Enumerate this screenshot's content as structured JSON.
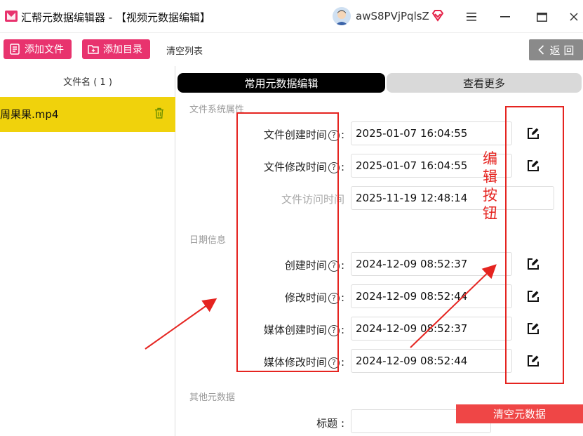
{
  "window": {
    "title": "汇帮元数据编辑器 - 【视频元数据编辑】",
    "username": "awS8PVjPqlsZ"
  },
  "toolbar": {
    "add_file": "添加文件",
    "add_folder": "添加目录",
    "clear_list": "清空列表",
    "back": "返 回"
  },
  "file_list": {
    "header": "文件名 ( 1 )",
    "files": [
      {
        "name": "周果果.mp4"
      }
    ]
  },
  "tabs": {
    "common": "常用元数据编辑",
    "more": "查看更多"
  },
  "sections": {
    "filesystem": "文件系统属性",
    "date": "日期信息",
    "other": "其他元数据"
  },
  "fields": {
    "file_created": {
      "label": "文件创建时间",
      "value": "2025-01-07 16:04:55"
    },
    "file_modified": {
      "label": "文件修改时间",
      "value": "2025-01-07 16:04:55"
    },
    "file_accessed": {
      "label": "文件访问时间",
      "value": "2025-11-19 12:48:14"
    },
    "created": {
      "label": "创建时间",
      "value": "2024-12-09 08:52:37"
    },
    "modified": {
      "label": "修改时间",
      "value": "2024-12-09 08:52:44"
    },
    "media_created": {
      "label": "媒体创建时间",
      "value": "2024-12-09 08:52:37"
    },
    "media_modified": {
      "label": "媒体修改时间",
      "value": "2024-12-09 08:52:44"
    },
    "title": {
      "label": "标题 :",
      "value": ""
    }
  },
  "annotation": {
    "text": "编辑按钮",
    "color": "#e52420"
  },
  "buttons": {
    "clear_metadata": "清空元数据"
  },
  "colors": {
    "accent_pink": "#e8336e",
    "selected_row": "#f0d20c",
    "clear_red": "#ef4646"
  },
  "icons": {
    "help": "?",
    "edit": "edit-icon"
  }
}
